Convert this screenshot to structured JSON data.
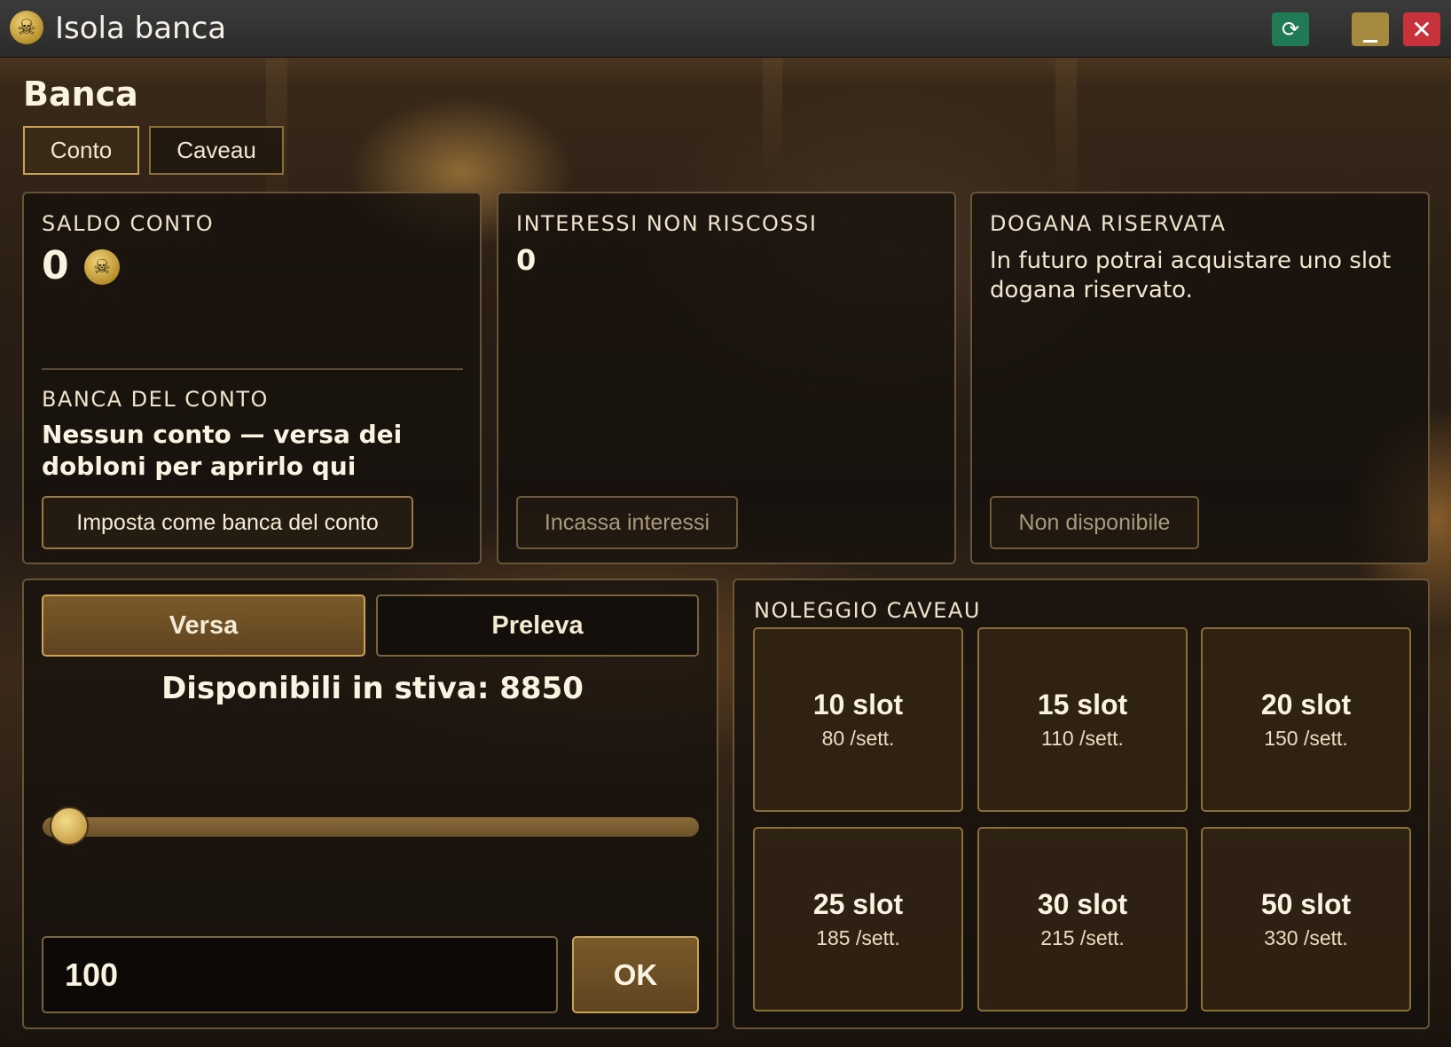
{
  "window": {
    "title": "Isola banca",
    "icons": {
      "app": "skull-coin-icon",
      "refresh": "refresh-icon",
      "minimize": "minimize-icon",
      "close": "close-icon"
    }
  },
  "page": {
    "title": "Banca"
  },
  "tabs": [
    {
      "label": "Conto",
      "active": true
    },
    {
      "label": "Caveau",
      "active": false
    }
  ],
  "balance": {
    "label": "SALDO CONTO",
    "value": "0",
    "bank_label": "BANCA DEL CONTO",
    "bank_value": "Nessun conto — versa dei dobloni per aprirlo qui",
    "set_bank_button": "Imposta come banca del conto"
  },
  "interest": {
    "label": "INTERESSI NON RISCOSSI",
    "value": "0",
    "collect_button": "Incassa interessi"
  },
  "customs": {
    "label": "DOGANA RISERVATA",
    "text": "In futuro potrai acquistare uno slot dogana riservato.",
    "button": "Non disponibile"
  },
  "transfer": {
    "deposit_label": "Versa",
    "withdraw_label": "Preleva",
    "mode": "deposit",
    "available_text": "Disponibili in stiva: 8850",
    "slider_fraction": 0.01,
    "amount": "100",
    "ok_label": "OK"
  },
  "vault_rental": {
    "label": "NOLEGGIO CAVEAU",
    "options": [
      {
        "slots": "10 slot",
        "price": "80 /sett."
      },
      {
        "slots": "15 slot",
        "price": "110 /sett."
      },
      {
        "slots": "20 slot",
        "price": "150 /sett."
      },
      {
        "slots": "25 slot",
        "price": "185 /sett."
      },
      {
        "slots": "30 slot",
        "price": "215 /sett."
      },
      {
        "slots": "50 slot",
        "price": "330 /sett."
      }
    ]
  },
  "colors": {
    "accent": "#c9a258",
    "panel_bg": "#16110d",
    "refresh": "#1f7a55",
    "minimize": "#a68a3f",
    "close": "#c8323a"
  }
}
